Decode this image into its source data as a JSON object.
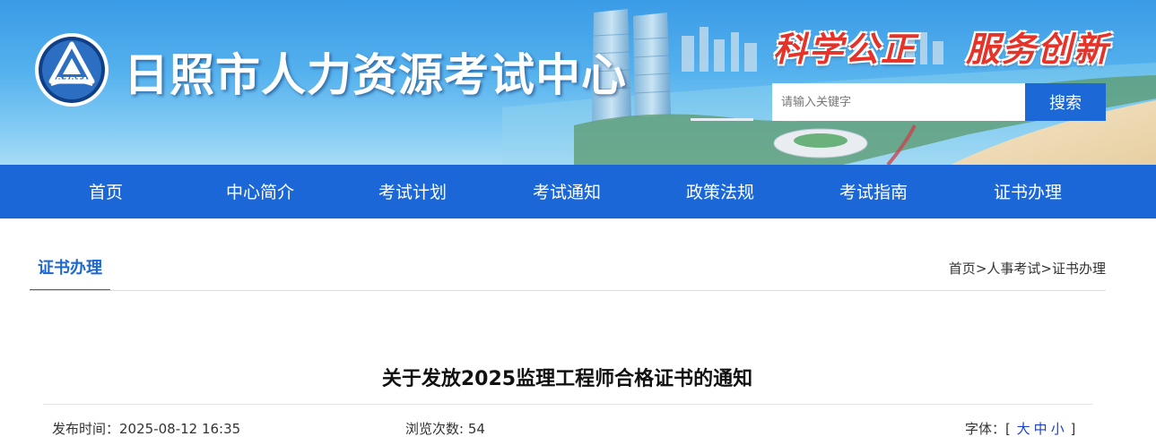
{
  "header": {
    "logo_text": "RZPTA",
    "site_title": "日照市人力资源考试中心",
    "slogan_left": "科学公正",
    "slogan_right": "服务创新"
  },
  "search": {
    "placeholder": "请输入关键字",
    "value": "",
    "button_label": "搜索",
    "button_color": "#1b68d6"
  },
  "nav": {
    "background": "#1c67d7",
    "items": [
      {
        "label": "首页"
      },
      {
        "label": "中心简介"
      },
      {
        "label": "考试计划"
      },
      {
        "label": "考试通知"
      },
      {
        "label": "政策法规"
      },
      {
        "label": "考试指南"
      },
      {
        "label": "证书办理"
      }
    ]
  },
  "section": {
    "title": "证书办理",
    "breadcrumb": [
      "首页",
      ">",
      "人事考试",
      ">",
      "证书办理"
    ]
  },
  "article": {
    "title": "关于发放2025监理工程师合格证书的通知",
    "publish_label": "发布时间：",
    "publish_time": "2025-08-12 16:35",
    "views_label": "浏览次数:",
    "views": "54",
    "font_label": "字体：",
    "font_open": "[",
    "font_large": "大",
    "font_medium": "中",
    "font_small": "小",
    "font_close": "]"
  }
}
